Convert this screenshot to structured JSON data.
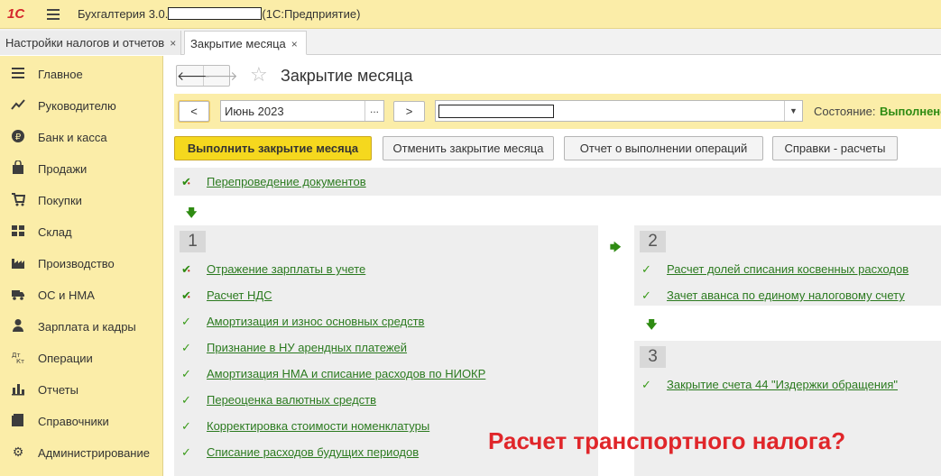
{
  "app": {
    "logo": "1С",
    "title_prefix": "Бухгалтерия 3.0.",
    "title_suffix": "(1С:Предприятие)"
  },
  "tabs": [
    {
      "label": "Настройки налогов и отчетов",
      "close": "×"
    },
    {
      "label": "Закрытие месяца",
      "close": "×"
    }
  ],
  "sidebar": {
    "items": [
      {
        "label": "Главное",
        "icon": "menu-lines-icon"
      },
      {
        "label": "Руководителю",
        "icon": "trend-icon"
      },
      {
        "label": "Банк и касса",
        "icon": "ruble-icon"
      },
      {
        "label": "Продажи",
        "icon": "bag-icon"
      },
      {
        "label": "Покупки",
        "icon": "cart-icon"
      },
      {
        "label": "Склад",
        "icon": "warehouse-icon"
      },
      {
        "label": "Производство",
        "icon": "factory-icon"
      },
      {
        "label": "ОС и НМА",
        "icon": "truck-icon"
      },
      {
        "label": "Зарплата и кадры",
        "icon": "person-icon"
      },
      {
        "label": "Операции",
        "icon": "dt-kt-icon"
      },
      {
        "label": "Отчеты",
        "icon": "bar-chart-icon"
      },
      {
        "label": "Справочники",
        "icon": "book-icon"
      },
      {
        "label": "Администрирование",
        "icon": "gear-icon"
      }
    ]
  },
  "page": {
    "title": "Закрытие месяца",
    "back": "🡐",
    "forward": "🡒"
  },
  "period": {
    "prev": "<",
    "value": "Июнь 2023",
    "choose": "...",
    "next": ">",
    "state_label": "Состояние:",
    "state_value": "Выполнено"
  },
  "actions": {
    "run": "Выполнить закрытие месяца",
    "cancel": "Отменить закрытие месяца",
    "report": "Отчет о выполнении операций",
    "refs": "Справки - расчеты"
  },
  "repost": {
    "label": "Перепроведение документов"
  },
  "steps": [
    {
      "number": "1",
      "operations": [
        {
          "label": "Отражение зарплаты в учете",
          "status": "done-with-doc"
        },
        {
          "label": "Расчет НДС",
          "status": "done-with-doc"
        },
        {
          "label": "Амортизация и износ основных средств",
          "status": "done"
        },
        {
          "label": "Признание в НУ арендных платежей",
          "status": "done"
        },
        {
          "label": "Амортизация НМА и списание расходов по НИОКР",
          "status": "done"
        },
        {
          "label": "Переоценка валютных средств",
          "status": "done"
        },
        {
          "label": "Корректировка стоимости номенклатуры",
          "status": "done"
        },
        {
          "label": "Списание расходов будущих периодов",
          "status": "done"
        }
      ]
    },
    {
      "number": "2",
      "operations": [
        {
          "label": "Расчет долей списания косвенных расходов",
          "status": "done"
        },
        {
          "label": "Зачет аванса по единому налоговому счету",
          "status": "done"
        }
      ]
    },
    {
      "number": "3",
      "operations": [
        {
          "label": "Закрытие счета 44 \"Издержки обращения\"",
          "status": "done"
        }
      ]
    }
  ],
  "overlay": {
    "question": "Расчет транспортного налога?"
  },
  "colors": {
    "accent_yellow": "#fbeda8",
    "link_green": "#2b7a1f",
    "alert_red": "#e0262a"
  }
}
